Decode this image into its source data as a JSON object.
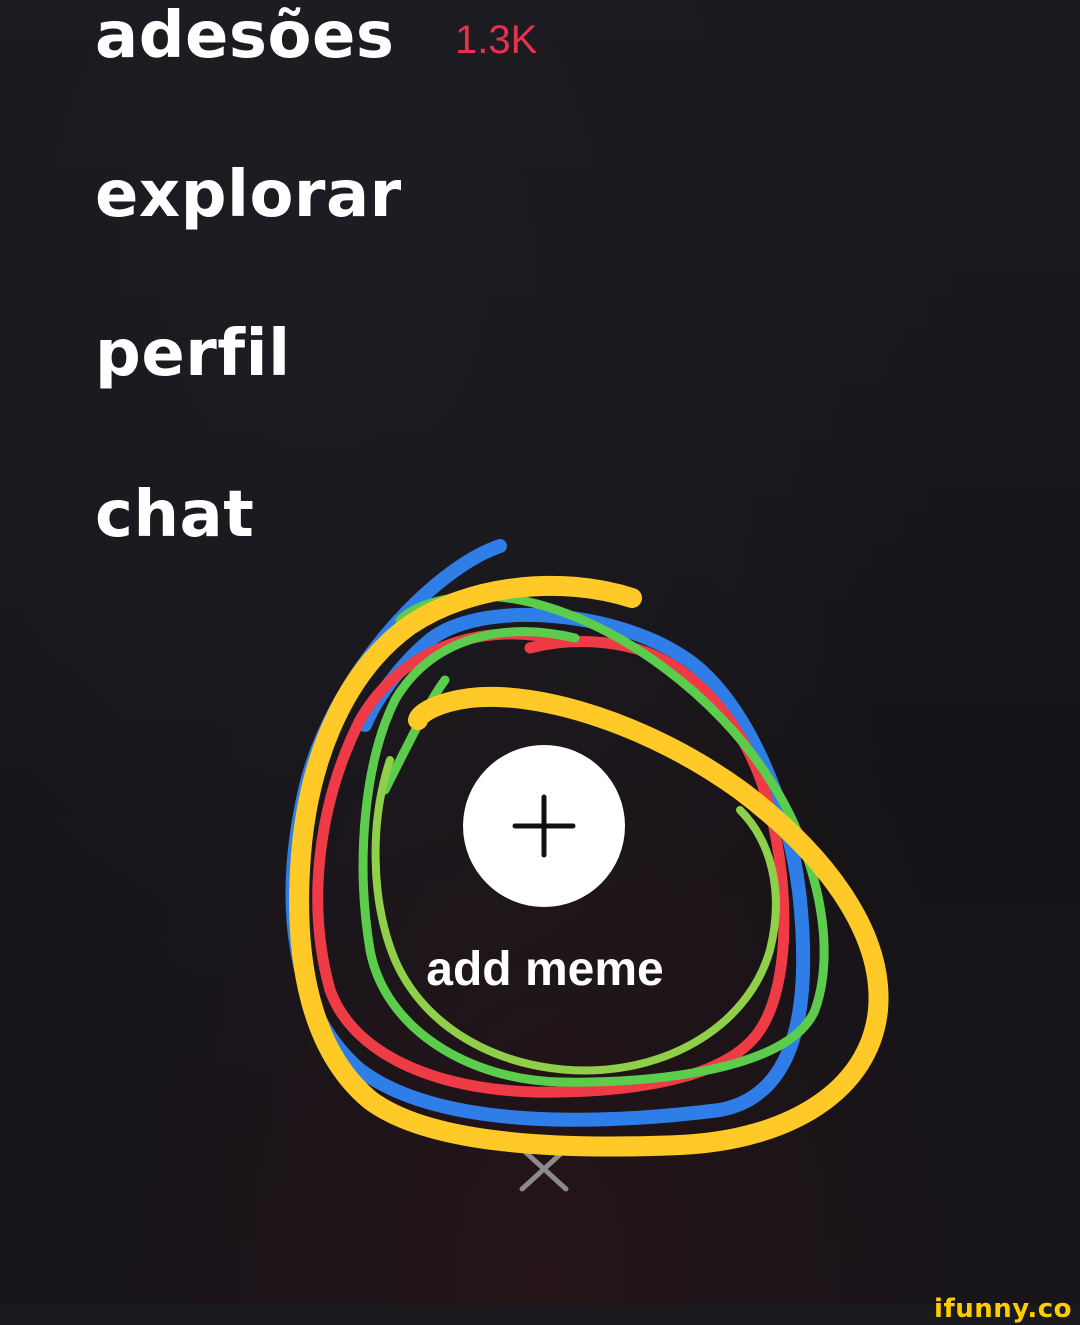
{
  "menu": {
    "items": [
      {
        "label": "adesões",
        "badge": "1.3K"
      },
      {
        "label": "explorar"
      },
      {
        "label": "perfil"
      },
      {
        "label": "chat"
      }
    ]
  },
  "add_action": {
    "label": "add meme",
    "icon": "plus-icon"
  },
  "close": {
    "icon": "close-icon"
  },
  "watermark": {
    "text": "ifunny.co"
  },
  "colors": {
    "badge": "#e8304f",
    "scribble_blue": "#2f7de6",
    "scribble_yellow": "#ffc928",
    "scribble_red": "#ee3b45",
    "scribble_green": "#5ccc4c",
    "watermark": "#ffcc00"
  }
}
